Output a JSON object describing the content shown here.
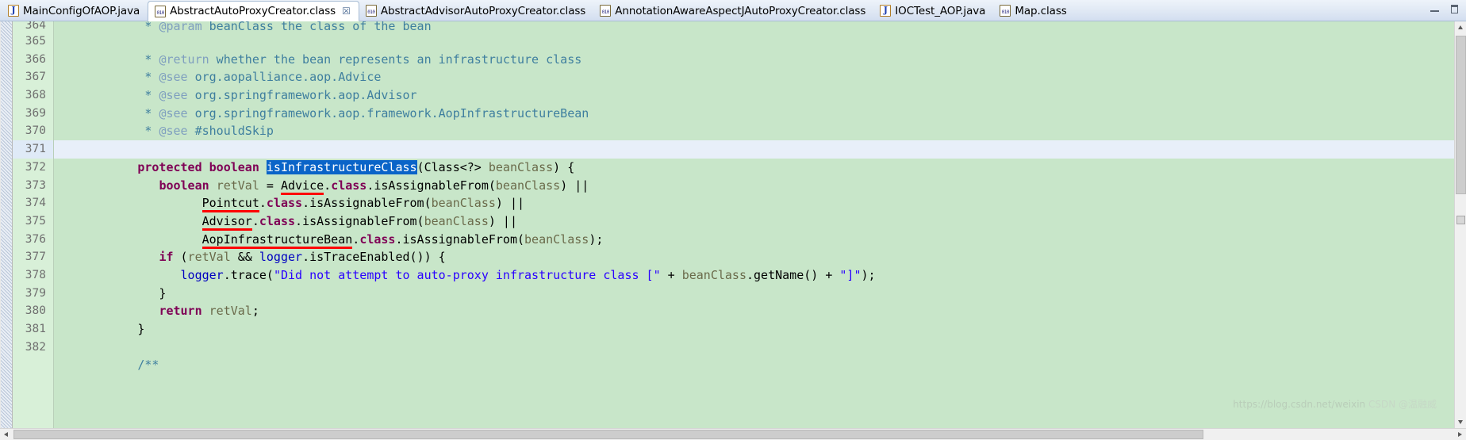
{
  "window": {
    "minimize_label": "–",
    "maximize_label": "□"
  },
  "tabs": [
    {
      "label": "MainConfigOfAOP.java",
      "icon": "java-file-icon",
      "active": false,
      "closable": false
    },
    {
      "label": "AbstractAutoProxyCreator.class",
      "icon": "class-file-icon",
      "active": true,
      "closable": true,
      "close_glyph": "☒"
    },
    {
      "label": "AbstractAdvisorAutoProxyCreator.class",
      "icon": "class-file-icon",
      "active": false,
      "closable": false
    },
    {
      "label": "AnnotationAwareAspectJAutoProxyCreator.class",
      "icon": "class-file-icon",
      "active": false,
      "closable": false
    },
    {
      "label": "IOCTest_AOP.java",
      "icon": "java-file-icon",
      "active": false,
      "closable": false
    },
    {
      "label": "Map.class",
      "icon": "class-file-icon",
      "active": false,
      "closable": false
    }
  ],
  "editor": {
    "language": "java",
    "background_color": "#c8e6c9",
    "current_line": 371,
    "selection_text": "isInfrastructureClass",
    "selection_color": "#0a64c8",
    "error_underline_color": "#ff0000",
    "line_numbers": [
      364,
      365,
      366,
      367,
      368,
      369,
      370,
      371,
      372,
      373,
      374,
      375,
      376,
      377,
      378,
      379,
      380,
      381,
      382
    ],
    "lines": [
      {
        "num": 364,
        "text": " * @param beanClass the class of the bean",
        "partial_top": true
      },
      {
        "num": 365,
        "text": " * @return whether the bean represents an infrastructure class"
      },
      {
        "num": 366,
        "text": " * @see org.aopalliance.aop.Advice"
      },
      {
        "num": 367,
        "text": " * @see org.springframework.aop.Advisor"
      },
      {
        "num": 368,
        "text": " * @see org.springframework.aop.framework.AopInfrastructureBean"
      },
      {
        "num": 369,
        "text": " * @see #shouldSkip"
      },
      {
        "num": 370,
        "text": " */"
      },
      {
        "num": 371,
        "text": "protected boolean isInfrastructureClass(Class<?> beanClass) {"
      },
      {
        "num": 372,
        "text": "boolean retVal = Advice.class.isAssignableFrom(beanClass) ||"
      },
      {
        "num": 373,
        "text": "Pointcut.class.isAssignableFrom(beanClass) ||"
      },
      {
        "num": 374,
        "text": "Advisor.class.isAssignableFrom(beanClass) ||"
      },
      {
        "num": 375,
        "text": "AopInfrastructureBean.class.isAssignableFrom(beanClass);"
      },
      {
        "num": 376,
        "text": "if (retVal && logger.isTraceEnabled()) {"
      },
      {
        "num": 377,
        "text": "logger.trace(\"Did not attempt to auto-proxy infrastructure class [\" + beanClass.getName() + \"]\");"
      },
      {
        "num": 378,
        "text": "}"
      },
      {
        "num": 379,
        "text": "return retVal;"
      },
      {
        "num": 380,
        "text": "}"
      },
      {
        "num": 381,
        "text": ""
      },
      {
        "num": 382,
        "text": "/**"
      }
    ],
    "underlined_identifiers": [
      "Advice",
      "Pointcut",
      "Advisor",
      "AopInfrastructureBean"
    ]
  },
  "watermark": {
    "url": "https://blog.csdn.net/weixin",
    "brand": "CSDN @温融威"
  },
  "scrollbars": {
    "vertical_up_arrow": "▲",
    "vertical_down_arrow": "▼",
    "horizontal_left_arrow": "◀",
    "horizontal_right_arrow": "▶"
  }
}
